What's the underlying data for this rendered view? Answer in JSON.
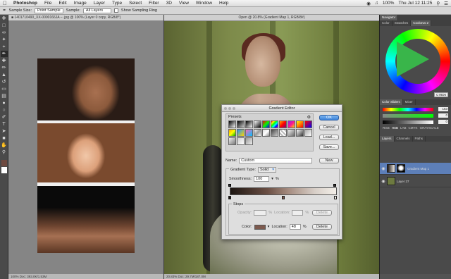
{
  "menubar": {
    "apple": "",
    "items": [
      "Photoshop",
      "File",
      "Edit",
      "Image",
      "Layer",
      "Type",
      "Select",
      "Filter",
      "3D",
      "View",
      "Window",
      "Help"
    ],
    "clock": "Thu Jul 12  11:25",
    "battery": "100%"
  },
  "options": {
    "sample_size_label": "Sample Size:",
    "sample_size_value": "Point Sample",
    "sample_label": "Sample:",
    "sample_value": "All Layers",
    "show_ring": "Show Sampling Ring"
  },
  "doc_left": {
    "tab": "■ 1401710490_XX-0000166JA – .jpg @ 100% (Layer 0 copy, RGB/8*)",
    "status": "100%    Doc: 393.0K/1.53M"
  },
  "doc_right": {
    "tab": "Open @ 20.8% (Gradient Map 1, RGB/8#)",
    "status": "20.83%    Doc: 29.7M/187.0M"
  },
  "gradient_editor": {
    "title": "Gradient Editor",
    "presets_label": "Presets",
    "ok": "OK",
    "cancel": "Cancel",
    "load": "Load...",
    "save": "Save...",
    "name_label": "Name:",
    "name_value": "Custom",
    "new_button": "New",
    "type_label": "Gradient Type:",
    "type_value": "Solid",
    "smoothness_label": "Smoothness:",
    "smoothness_value": "100",
    "smoothness_unit": "%",
    "stops_label": "Stops",
    "opacity_label": "Opacity:",
    "opacity_unit": "%",
    "location_label_top": "Location:",
    "location_unit_top": "%",
    "delete_top": "Delete",
    "color_label": "Color:",
    "color_value": "#7d5a4e",
    "location_label": "Location:",
    "location_value": "48",
    "location_unit": "%",
    "delete": "Delete"
  },
  "panels": {
    "navigator_tab": "Navigator",
    "tabs_top": [
      "Color",
      "Swatches",
      "Coolorus 2"
    ],
    "hex": "C78D6",
    "color_sliders_header": "Color Sliders",
    "color_sliders_tab2": "Mixer",
    "slider_values": [
      "153",
      "0",
      "0"
    ],
    "modes": [
      "RGB",
      "HSB",
      "LAB",
      "CMYK",
      "GRAYSCALE"
    ],
    "layers_tabs": [
      "Layers",
      "Channels",
      "Paths"
    ],
    "layers": [
      {
        "name": "Gradient Map 1",
        "selected": true
      },
      {
        "name": "Layer 37",
        "selected": false
      }
    ]
  }
}
